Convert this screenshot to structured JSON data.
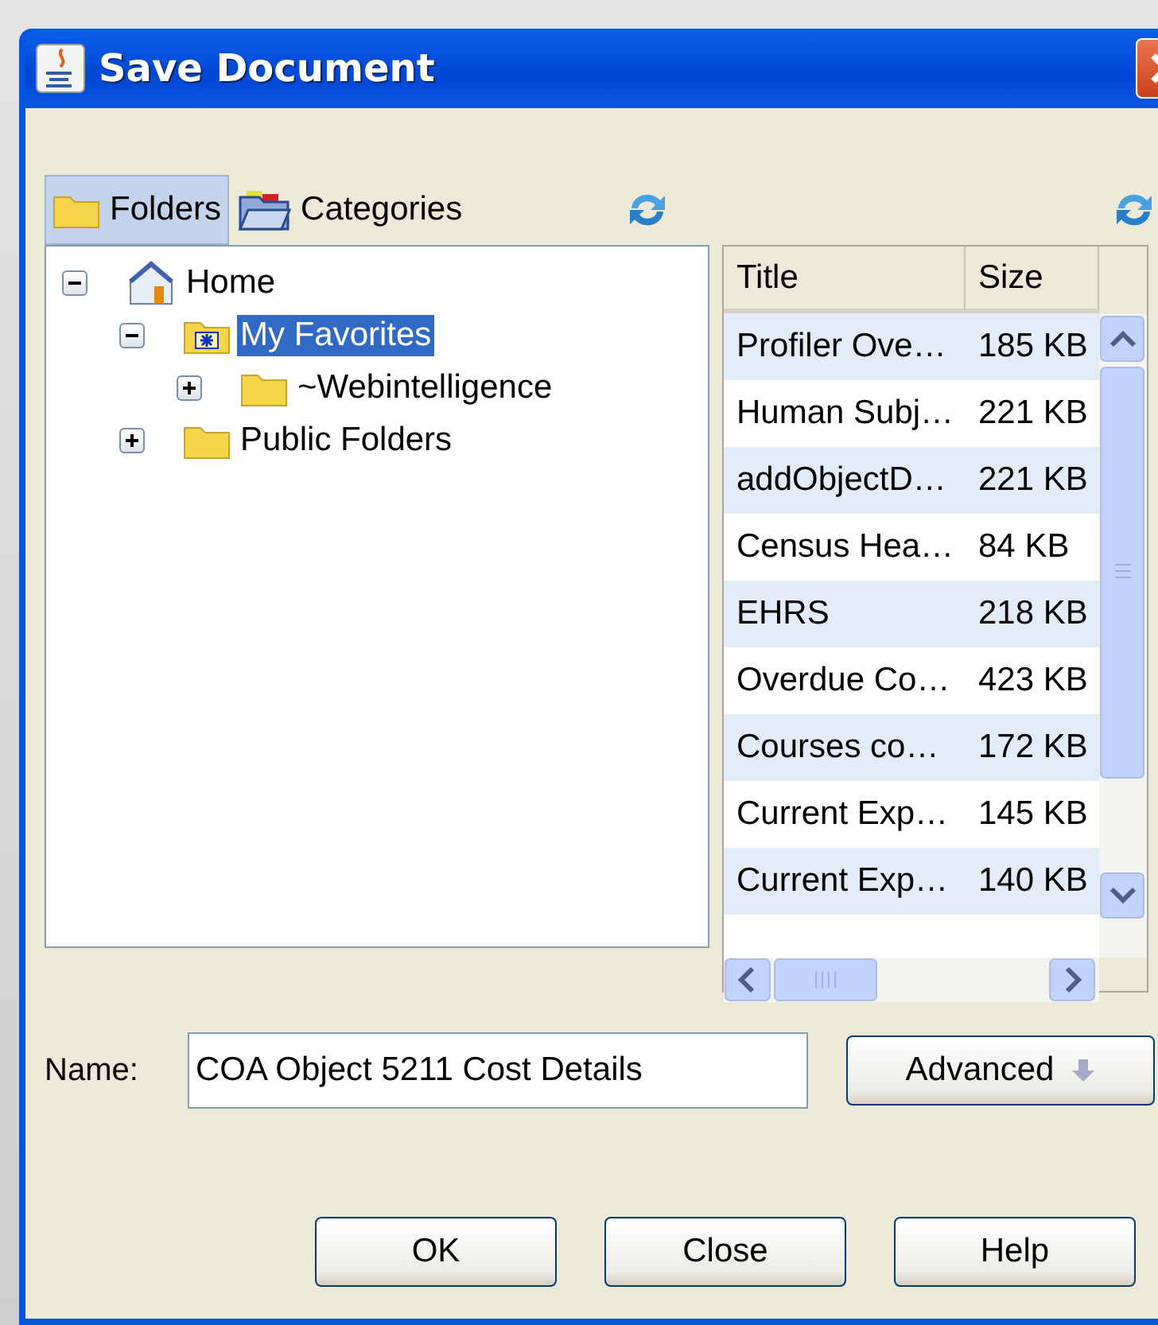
{
  "window": {
    "title": "Save Document"
  },
  "tabs": [
    {
      "label": "Folders",
      "kind": "folder",
      "selected": true
    },
    {
      "label": "Categories",
      "kind": "categories",
      "selected": false
    }
  ],
  "tree": [
    {
      "label": "Home",
      "kind": "home",
      "expanded": true,
      "selected": false,
      "children": [
        {
          "label": "My Favorites",
          "kind": "favorites",
          "expanded": true,
          "selected": true,
          "children": [
            {
              "label": "~Webintelligence",
              "kind": "folder",
              "expanded": false,
              "selected": false
            }
          ]
        },
        {
          "label": "Public Folders",
          "kind": "folder",
          "expanded": false,
          "selected": false
        }
      ]
    }
  ],
  "table": {
    "columns": [
      "Title",
      "Size"
    ],
    "rows": [
      [
        "Profiler Ove…",
        "185 KB"
      ],
      [
        "Human Subj…",
        "221 KB"
      ],
      [
        "addObjectD…",
        "221 KB"
      ],
      [
        "Census Hea…",
        "84 KB"
      ],
      [
        "EHRS",
        "218 KB"
      ],
      [
        "Overdue Co…",
        "423 KB"
      ],
      [
        "Courses co…",
        "172 KB"
      ],
      [
        "Current Exp…",
        "145 KB"
      ],
      [
        "Current Exp…",
        "140 KB"
      ]
    ]
  },
  "name_field": {
    "label": "Name:",
    "value": "COA Object 5211 Cost Details"
  },
  "advanced_button": "Advanced",
  "buttons": [
    "OK",
    "Close",
    "Help"
  ]
}
